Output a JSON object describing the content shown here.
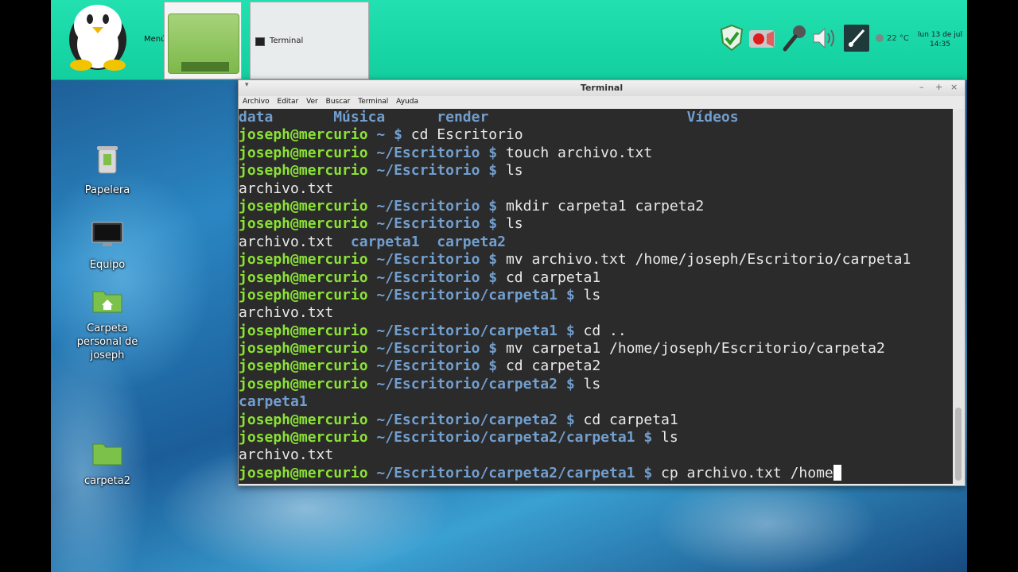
{
  "panel": {
    "menu_label": "Menú",
    "taskbar": [
      {
        "label": ""
      },
      {
        "label": "Terminal"
      }
    ],
    "weather": "22 °C",
    "clock_date": "lun 13 de jul",
    "clock_time": "14:35",
    "accent": "#17d9a8"
  },
  "desktop": {
    "icons": [
      {
        "label": "Papelera",
        "icon": "trash-icon"
      },
      {
        "label": "Equipo",
        "icon": "computer-icon"
      },
      {
        "label": "Carpeta personal de joseph",
        "icon": "home-folder-icon"
      },
      {
        "label": "carpeta2",
        "icon": "folder-icon"
      }
    ]
  },
  "window": {
    "title": "Terminal",
    "controls": [
      "–",
      "+",
      "×"
    ],
    "menu": [
      "Archivo",
      "Editar",
      "Ver",
      "Buscar",
      "Terminal",
      "Ayuda"
    ]
  },
  "terminal": {
    "header_dirs": [
      "data",
      "Música",
      "render",
      "Vídeos"
    ],
    "user": "joseph@mercurio",
    "lines": [
      {
        "path": "~",
        "cmd": "cd Escritorio"
      },
      {
        "path": "~/Escritorio",
        "cmd": "touch archivo.txt"
      },
      {
        "path": "~/Escritorio",
        "cmd": "ls"
      },
      {
        "out": "archivo.txt"
      },
      {
        "path": "~/Escritorio",
        "cmd": "mkdir carpeta1 carpeta2"
      },
      {
        "path": "~/Escritorio",
        "cmd": "ls"
      },
      {
        "out": "archivo.txt",
        "dirs": [
          "carpeta1",
          "carpeta2"
        ]
      },
      {
        "path": "~/Escritorio",
        "cmd": "mv archivo.txt /home/joseph/Escritorio/carpeta1"
      },
      {
        "path": "~/Escritorio",
        "cmd": "cd carpeta1"
      },
      {
        "path": "~/Escritorio/carpeta1",
        "cmd": "ls"
      },
      {
        "out": "archivo.txt"
      },
      {
        "path": "~/Escritorio/carpeta1",
        "cmd": "cd .."
      },
      {
        "path": "~/Escritorio",
        "cmd": "mv carpeta1 /home/joseph/Escritorio/carpeta2"
      },
      {
        "path": "~/Escritorio",
        "cmd": "cd carpeta2"
      },
      {
        "path": "~/Escritorio/carpeta2",
        "cmd": "ls"
      },
      {
        "dirs": [
          "carpeta1"
        ]
      },
      {
        "path": "~/Escritorio/carpeta2",
        "cmd": "cd carpeta1"
      },
      {
        "path": "~/Escritorio/carpeta2/carpeta1",
        "cmd": "ls"
      },
      {
        "out": "archivo.txt"
      },
      {
        "path": "~/Escritorio/carpeta2/carpeta1",
        "cmd": "cp archivo.txt /home",
        "cursor": true
      }
    ]
  }
}
